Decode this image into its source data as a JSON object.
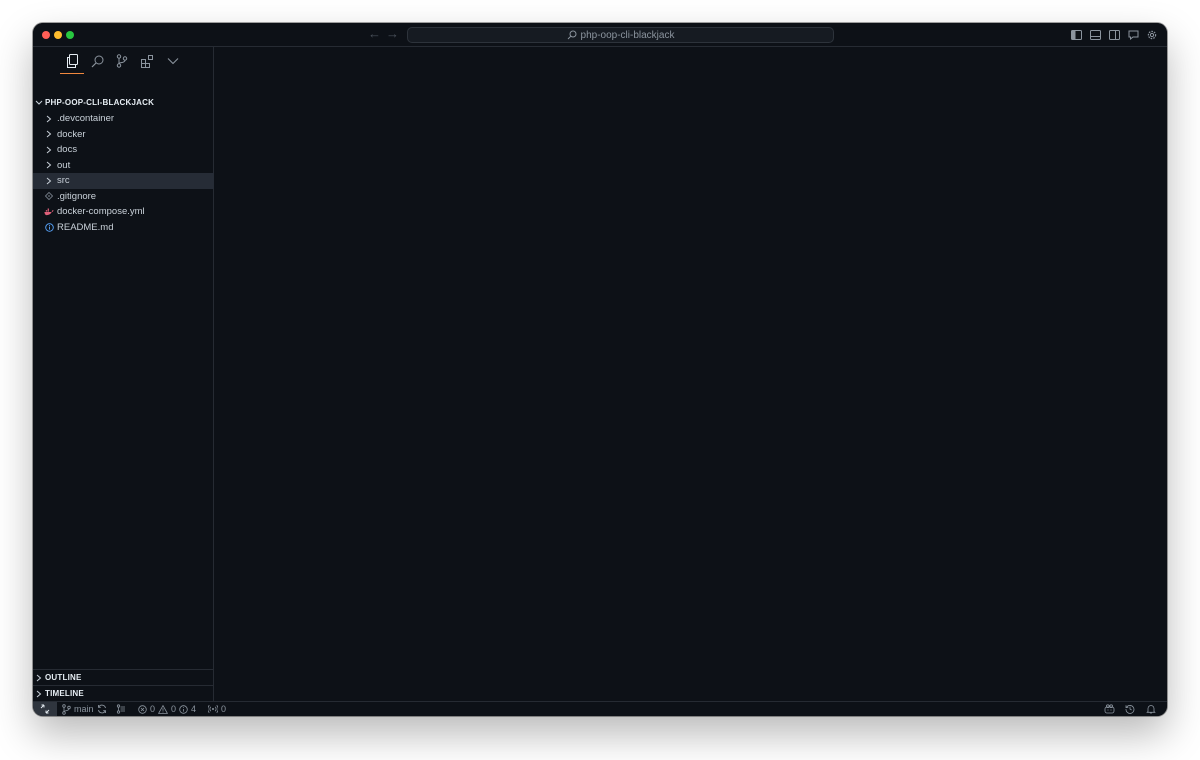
{
  "window": {
    "search_text": "php-oop-cli-blackjack"
  },
  "activity_bar": {
    "items": [
      "explorer-icon",
      "search-icon",
      "source-control-icon",
      "extensions-icon",
      "chevron-down-icon"
    ]
  },
  "explorer": {
    "root_label": "PHP-OOP-CLI-BLACKJACK",
    "items": [
      {
        "label": ".devcontainer",
        "type": "folder"
      },
      {
        "label": "docker",
        "type": "folder"
      },
      {
        "label": "docs",
        "type": "folder"
      },
      {
        "label": "out",
        "type": "folder"
      },
      {
        "label": "src",
        "type": "folder",
        "selected": true
      },
      {
        "label": ".gitignore",
        "type": "file",
        "icon": "git-file-icon"
      },
      {
        "label": "docker-compose.yml",
        "type": "file",
        "icon": "docker-file-icon"
      },
      {
        "label": "README.md",
        "type": "file",
        "icon": "info-file-icon"
      }
    ]
  },
  "panels": {
    "outline": "OUTLINE",
    "timeline": "TIMELINE"
  },
  "statusbar": {
    "branch": "main",
    "errors": "0",
    "warnings": "0",
    "infos": "4",
    "ports": "0"
  },
  "colors": {
    "accent": "#f0883e",
    "docker": "#e0607a",
    "info": "#58a6ff",
    "background": "#0d1117"
  }
}
